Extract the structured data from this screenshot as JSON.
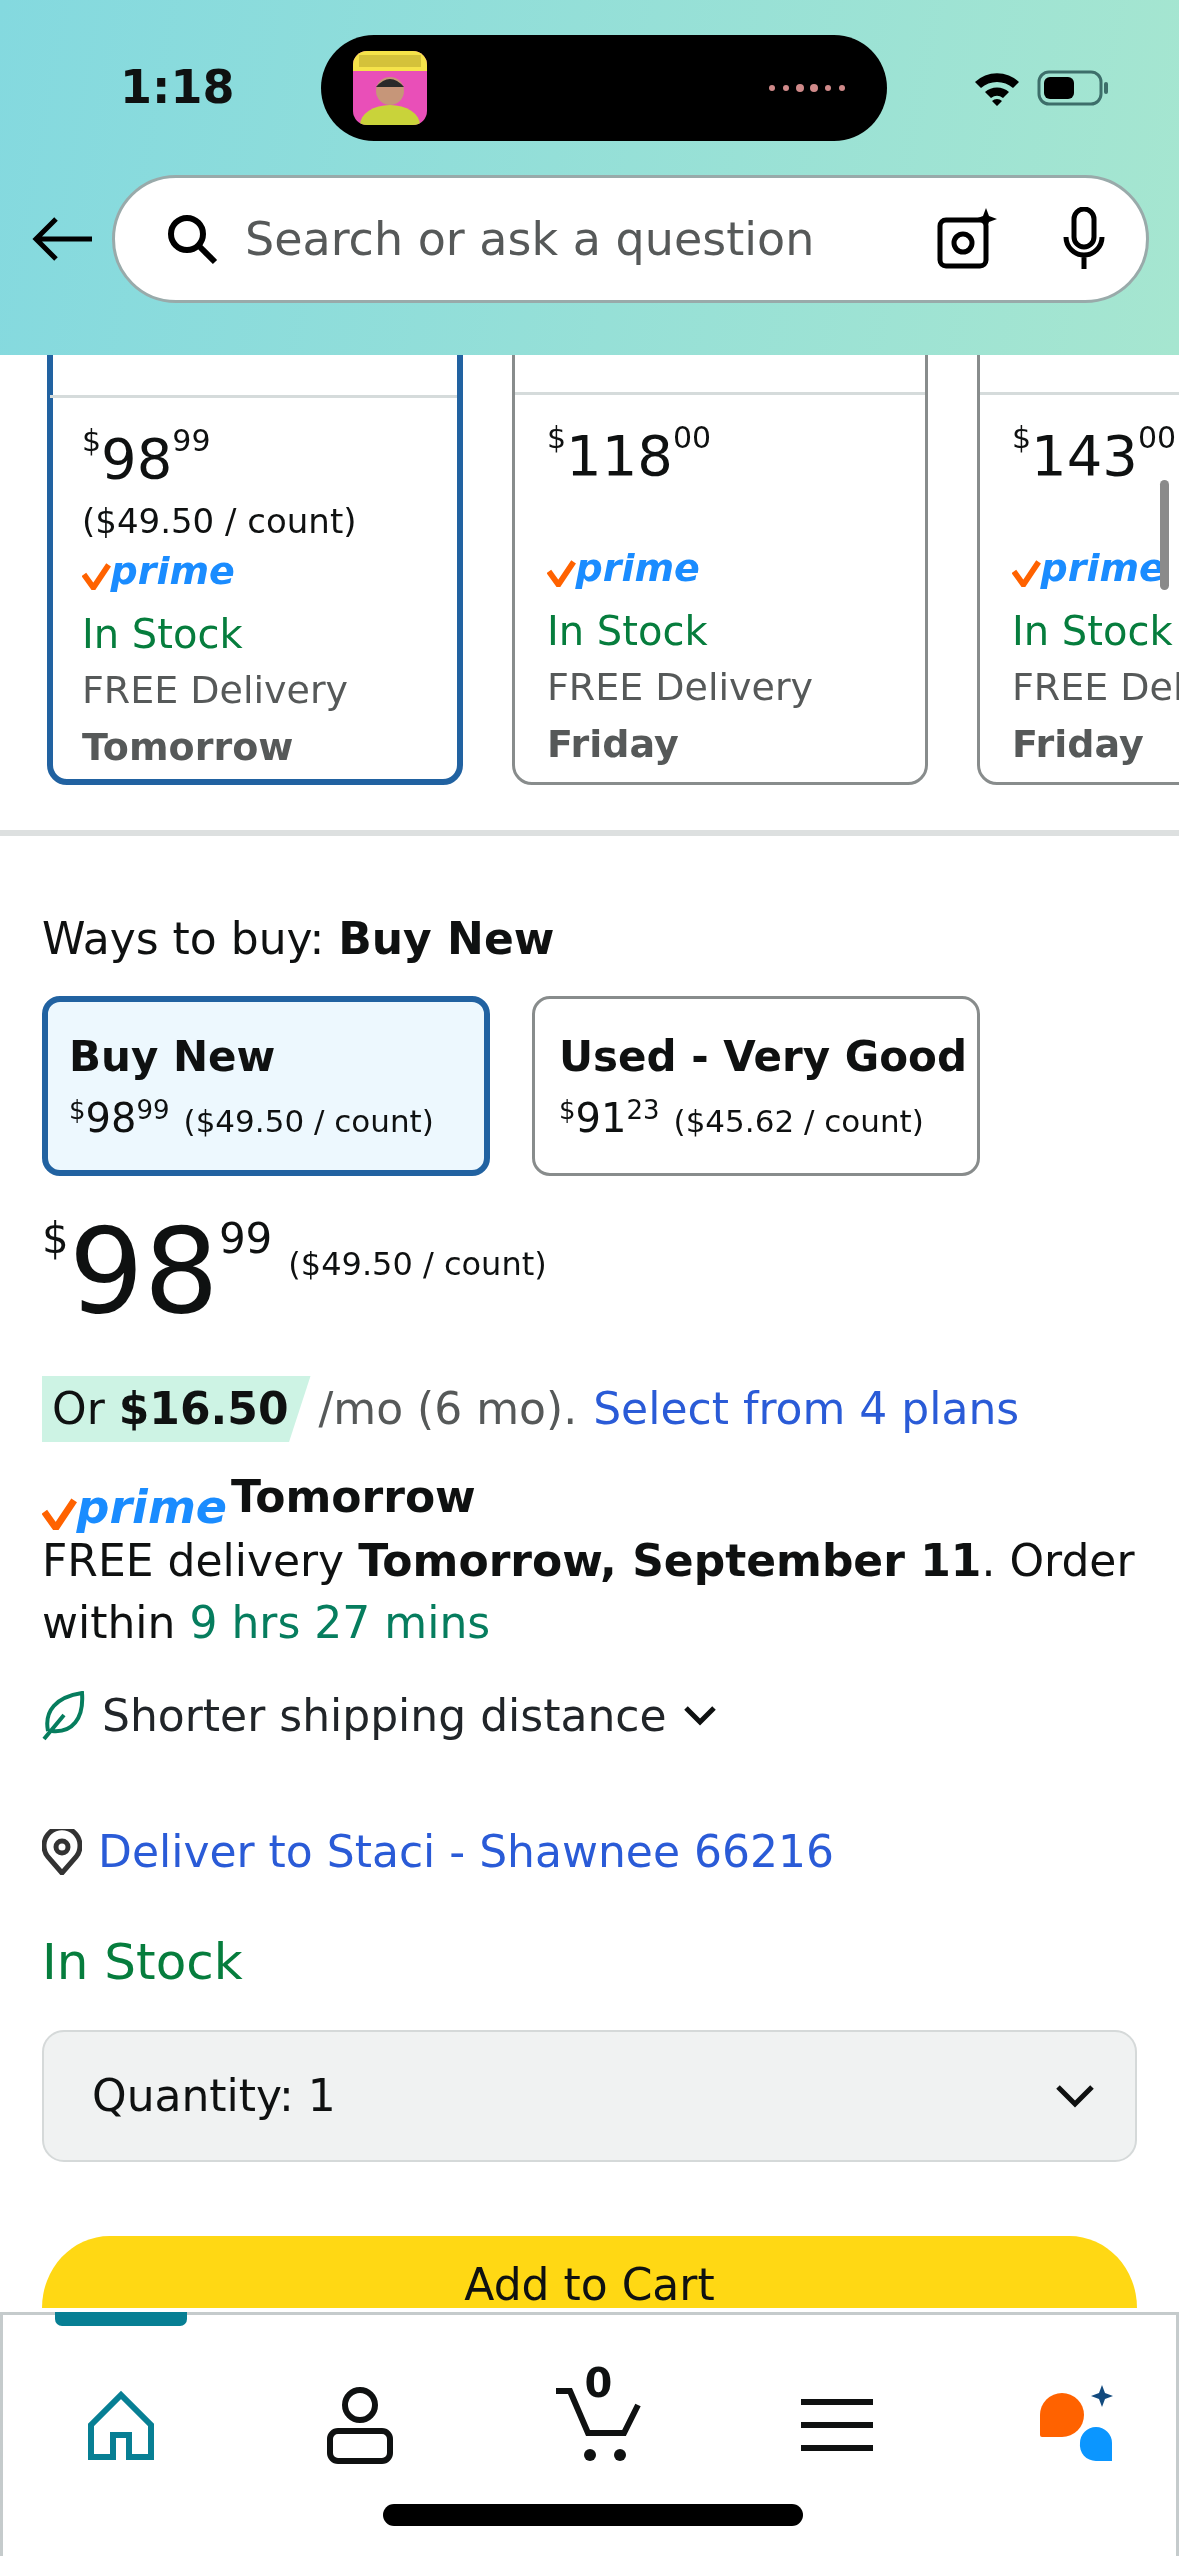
{
  "status_bar": {
    "time": "1:18"
  },
  "search": {
    "placeholder": "Search or ask a question"
  },
  "variants": [
    {
      "price_symbol": "$",
      "price_whole": "98",
      "price_fraction": "99",
      "unit_price": "($49.50 / count)",
      "prime_badge": "prime",
      "stock": "In Stock",
      "delivery": "FREE Delivery",
      "delivery_day": "Tomorrow",
      "selected": true
    },
    {
      "price_symbol": "$",
      "price_whole": "118",
      "price_fraction": "00",
      "prime_badge": "prime",
      "stock": "In Stock",
      "delivery": "FREE Delivery",
      "delivery_day": "Friday",
      "selected": false
    },
    {
      "price_symbol": "$",
      "price_whole": "143",
      "price_fraction": "00",
      "prime_badge": "prime",
      "stock": "In Stock",
      "delivery": "FREE Del",
      "delivery_day": "Friday",
      "selected": false
    }
  ],
  "ways_to_buy": "Ways to buy: **Buy New**",
  "buy_options": [
    {
      "title": "Buy New",
      "price_symbol": "$",
      "price_whole": "98",
      "price_fraction": "99",
      "unit_price": "($49.50 / count)",
      "selected": true
    },
    {
      "title": "Used - Very Good",
      "price_symbol": "$",
      "price_whole": "91",
      "price_fraction": "23",
      "unit_price": "($45.62 / count)",
      "selected": false
    }
  ],
  "price": {
    "symbol": "$",
    "whole": "98",
    "fraction": "99",
    "unit_price": "($49.50 / count)"
  },
  "installment": {
    "offer": "Or **$16.50**",
    "terms": "/mo (6 mo).",
    "link": "Select from 4 plans"
  },
  "delivery": {
    "prime_badge": "prime",
    "speed": "Tomorrow",
    "message": "FREE delivery **Tomorrow, September 11**. Order within",
    "countdown": "9 hrs 27 mins"
  },
  "sustainability": {
    "label": "Shorter shipping distance",
    "expanded": false
  },
  "location": {
    "label": "Deliver to Staci - Shawnee 66216"
  },
  "availability": "In Stock",
  "quantity": {
    "label": "Quantity:",
    "value": "1"
  },
  "add_to_cart": "Add to Cart",
  "bottom_nav": [
    {
      "kind": "home",
      "selected": true
    },
    {
      "kind": "account",
      "selected": false
    },
    {
      "kind": "cart",
      "count": "0",
      "selected": false
    },
    {
      "kind": "menu",
      "selected": false
    },
    {
      "kind": "assistant",
      "selected": false
    }
  ]
}
